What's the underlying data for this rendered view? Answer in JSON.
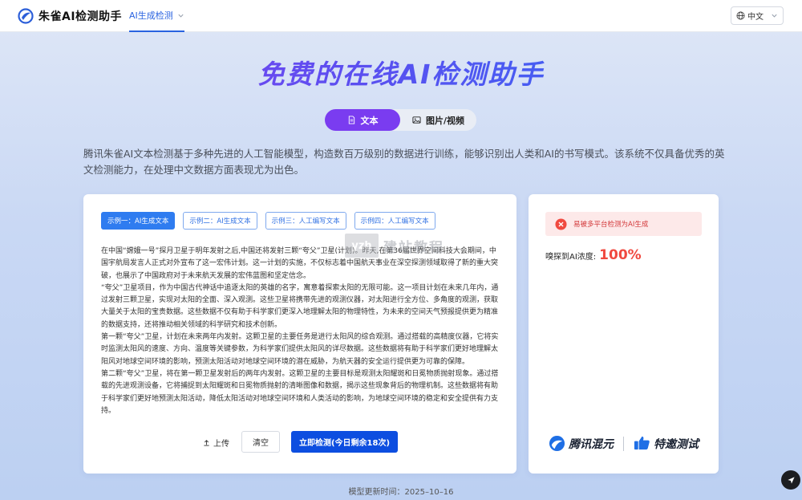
{
  "nav": {
    "brand": "朱雀AI检测助手",
    "tab": "AI生成检测",
    "language": "中文"
  },
  "hero": {
    "title": "免费的在线AI检测助手"
  },
  "mode": {
    "text": "文本",
    "image": "图片/视频"
  },
  "intro": "腾讯朱雀AI文本检测基于多种先进的人工智能模型，构造数百万级别的数据进行训练，能够识别出人类和AI的书写模式。该系统不仅具备优秀的英文检测能力，在处理中文数据方面表现尤为出色。",
  "examples": [
    {
      "label": "示例一：AI生成文本"
    },
    {
      "label": "示例二：AI生成文本"
    },
    {
      "label": "示例三：人工编写文本"
    },
    {
      "label": "示例四：人工编写文本"
    }
  ],
  "sample_text": [
    "在中国“嫦娥一号”探月卫星于明年发射之后,中国还将发射三颗“夸父”卫星(计划)。昨天,在第36届世界空间科技大会期间，中国宇航局发言人正式对外宣布了这一宏伟计划。这一计划的实施，不仅标志着中国航天事业在深空探测领域取得了新的重大突破，也展示了中国政府对于未来航天发展的宏伟蓝图和坚定信念。",
    "“夸父”卫星项目，作为中国古代神话中追逐太阳的英雄的名字，寓意着探索太阳的无限可能。这一项目计划在未来几年内，通过发射三颗卫星，实现对太阳的全面、深入观测。这些卫星将携带先进的观测仪器，对太阳进行全方位、多角度的观测，获取大量关于太阳的宝贵数据。这些数据不仅有助于科学家们更深入地理解太阳的物理特性，为未来的空间天气预报提供更为精准的数据支持，还将推动相关领域的科学研究和技术创新。",
    "第一颗“夸父”卫星，计划在未来两年内发射。这颗卫星的主要任务是进行太阳风的综合观测。通过搭载的高精度仪器，它将实时监测太阳风的速度、方向、温度等关键参数，为科学家们提供太阳风的详尽数据。这些数据将有助于科学家们更好地理解太阳风对地球空间环境的影响，预测太阳活动对地球空间环境的潜在威胁，为航天器的安全运行提供更为可靠的保障。",
    "第二颗“夸父”卫星，将在第一颗卫星发射后的两年内发射。这颗卫星的主要目标是观测太阳耀斑和日冕物质抛射现象。通过搭载的先进观测设备，它将捕捉到太阳耀斑和日冕物质抛射的清晰图像和数据，揭示这些现象背后的物理机制。这些数据将有助于科学家们更好地预测太阳活动，降低太阳活动对地球空间环境和人类活动的影响，为地球空间环境的稳定和安全提供有力支持。"
  ],
  "watermark": {
    "box": "yzh",
    "text": "建站教程"
  },
  "actions": {
    "upload": "上传",
    "clear": "清空",
    "detect": "立即检测(今日剩余18次)"
  },
  "result": {
    "alert": "易被多平台检测为AI生成",
    "score_label": "嗅探到AI浓度:",
    "score_value": "100%"
  },
  "partners": {
    "left": "腾讯混元",
    "right": "特邀测试"
  },
  "footer": {
    "model_time": "模型更新时间：2025–10–16"
  },
  "colors": {
    "accent": "#7a3cf0",
    "primary": "#0d4ee0",
    "danger": "#f0493f",
    "link": "#2a63e0"
  }
}
